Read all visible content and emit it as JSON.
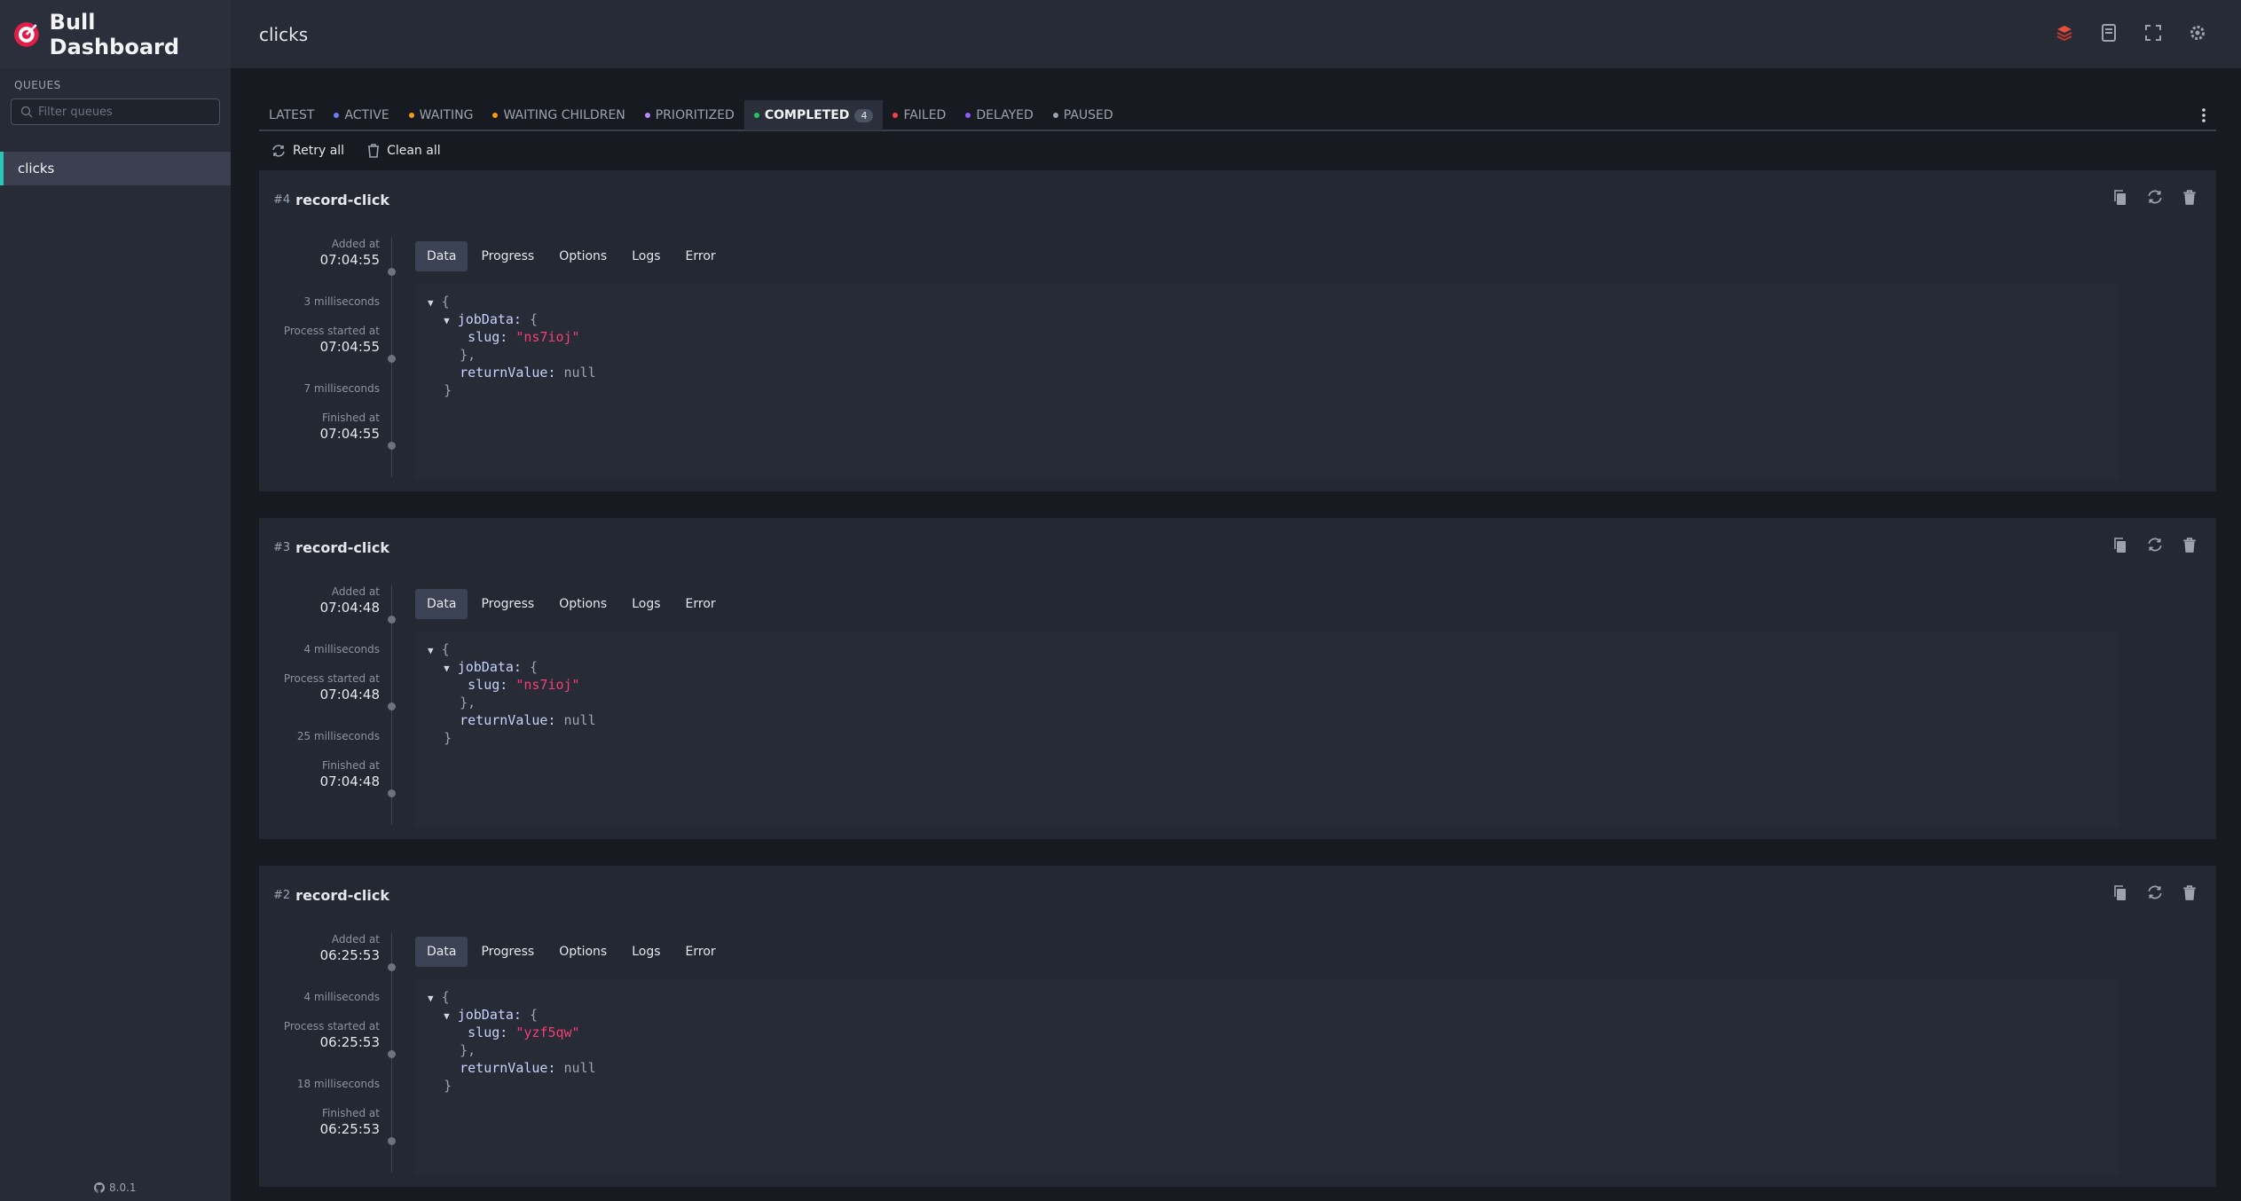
{
  "app": {
    "name": "Bull Dashboard",
    "version": "8.0.1"
  },
  "sidebar": {
    "queues_title": "QUEUES",
    "filter_placeholder": "Filter queues",
    "queues": [
      {
        "label": "clicks"
      }
    ]
  },
  "header": {
    "title": "clicks"
  },
  "status_tabs": [
    {
      "label": "LATEST",
      "color": ""
    },
    {
      "label": "ACTIVE",
      "color": "#6d7cf5"
    },
    {
      "label": "WAITING",
      "color": "#f59e0b"
    },
    {
      "label": "WAITING CHILDREN",
      "color": "#f59e0b"
    },
    {
      "label": "PRIORITIZED",
      "color": "#c084fc"
    },
    {
      "label": "COMPLETED",
      "color": "#22c55e",
      "count": "4",
      "selected": true
    },
    {
      "label": "FAILED",
      "color": "#ef4444"
    },
    {
      "label": "DELAYED",
      "color": "#8b5cf6"
    },
    {
      "label": "PAUSED",
      "color": "#9ca3af"
    }
  ],
  "actions": {
    "retry_all": "Retry all",
    "clean_all": "Clean all"
  },
  "detail_tabs": [
    "Data",
    "Progress",
    "Options",
    "Logs",
    "Error"
  ],
  "timeline_labels": {
    "added": "Added at",
    "started": "Process started at",
    "finished": "Finished at"
  },
  "jobs": [
    {
      "id": "#4",
      "name": "record-click",
      "added": "07:04:55",
      "wait": "3 milliseconds",
      "started": "07:04:55",
      "run": "7 milliseconds",
      "finished": "07:04:55",
      "data": {
        "key_job": "jobData:",
        "key_slug": "slug:",
        "slug": "\"ns7ioj\"",
        "key_return": "returnValue:",
        "return_value": "null"
      }
    },
    {
      "id": "#3",
      "name": "record-click",
      "added": "07:04:48",
      "wait": "4 milliseconds",
      "started": "07:04:48",
      "run": "25 milliseconds",
      "finished": "07:04:48",
      "data": {
        "key_job": "jobData:",
        "key_slug": "slug:",
        "slug": "\"ns7ioj\"",
        "key_return": "returnValue:",
        "return_value": "null"
      }
    },
    {
      "id": "#2",
      "name": "record-click",
      "added": "06:25:53",
      "wait": "4 milliseconds",
      "started": "06:25:53",
      "run": "18 milliseconds",
      "finished": "06:25:53",
      "data": {
        "key_job": "jobData:",
        "key_slug": "slug:",
        "slug": "\"yzf5qw\"",
        "key_return": "returnValue:",
        "return_value": "null"
      }
    }
  ]
}
